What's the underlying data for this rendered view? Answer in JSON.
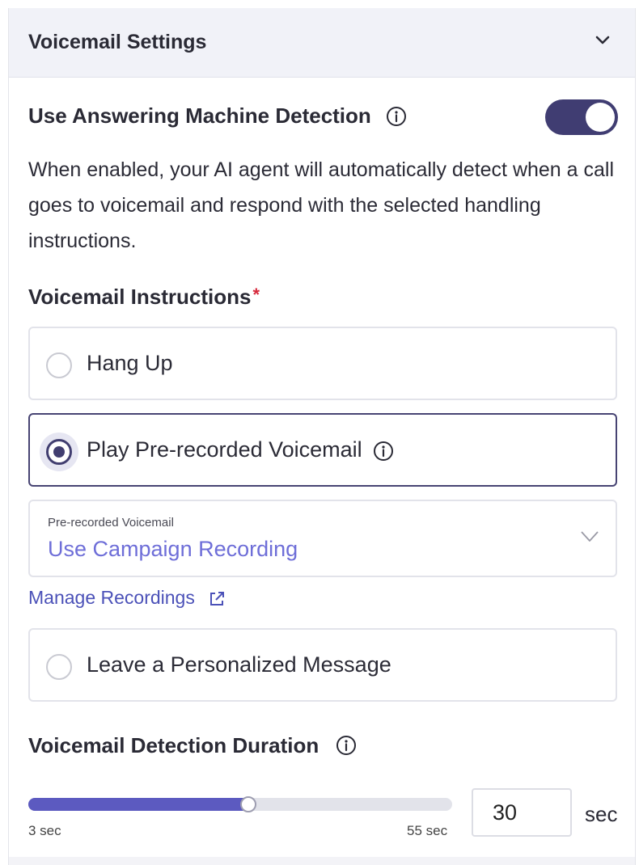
{
  "header": {
    "title": "Voicemail Settings",
    "collapse_icon": "chevron-down-icon"
  },
  "amd": {
    "label": "Use Answering Machine Detection",
    "enabled": true,
    "description": "When enabled, your AI agent will automatically detect when a call goes to voicemail and respond with the selected handling instructions."
  },
  "instructions": {
    "label": "Voicemail Instructions",
    "required_mark": "*",
    "options": [
      {
        "label": "Hang Up",
        "selected": false
      },
      {
        "label": "Play Pre-recorded Voicemail",
        "selected": true
      },
      {
        "label": "Leave a Personalized Message",
        "selected": false
      }
    ],
    "recording_select": {
      "caption": "Pre-recorded Voicemail",
      "value": "Use Campaign Recording"
    },
    "manage_link": "Manage Recordings"
  },
  "duration": {
    "label": "Voicemail Detection Duration",
    "min_label": "3 sec",
    "max_label": "55 sec",
    "min": 3,
    "max": 55,
    "value": "30",
    "unit": "sec"
  },
  "colors": {
    "accent": "#403d72",
    "slider": "#5c5ac0",
    "link": "#4b51b8",
    "select_value": "#6e6ed8",
    "required": "#d6283b"
  }
}
